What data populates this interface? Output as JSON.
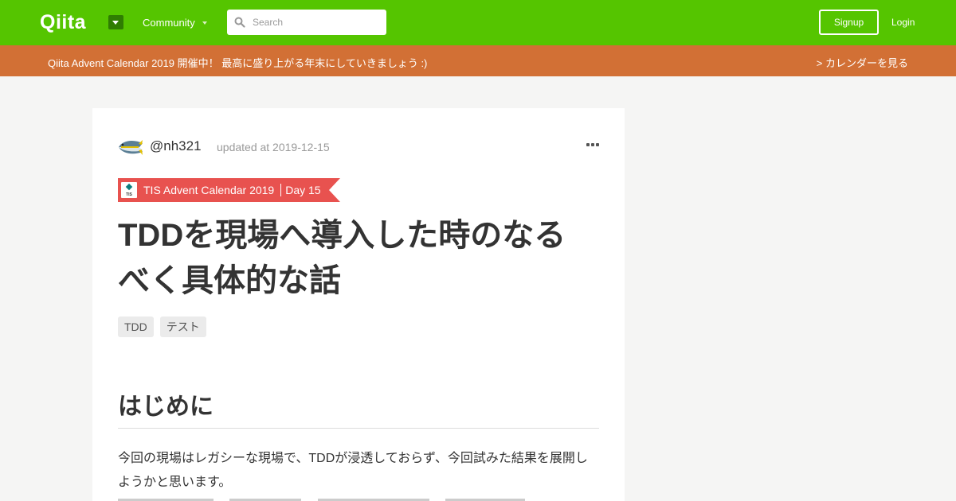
{
  "header": {
    "logo_text": "Qiita",
    "community_label": "Community",
    "search_placeholder": "Search",
    "signup_label": "Signup",
    "login_label": "Login",
    "brand_color": "#55c500"
  },
  "banner": {
    "message": "Qiita Advent Calendar 2019 開催中！ 最高に盛り上がる年末にしていきましょう :)",
    "calendar_link": "> カレンダーを見る",
    "color": "#d27035"
  },
  "article": {
    "author": "@nh321",
    "updated": "updated at 2019-12-15",
    "calendar": {
      "logo_text": "TIS",
      "title": "TIS Advent Calendar 2019",
      "day": "Day 15",
      "color": "#e8524f"
    },
    "title": "TDDを現場へ導入した時のなるべく具体的な話",
    "tags": [
      "TDD",
      "テスト"
    ],
    "section_heading": "はじめに",
    "paragraph": "今回の現場はレガシーな現場で、TDDが浸透しておらず、今回試みた結果を展開しようかと思います。"
  }
}
